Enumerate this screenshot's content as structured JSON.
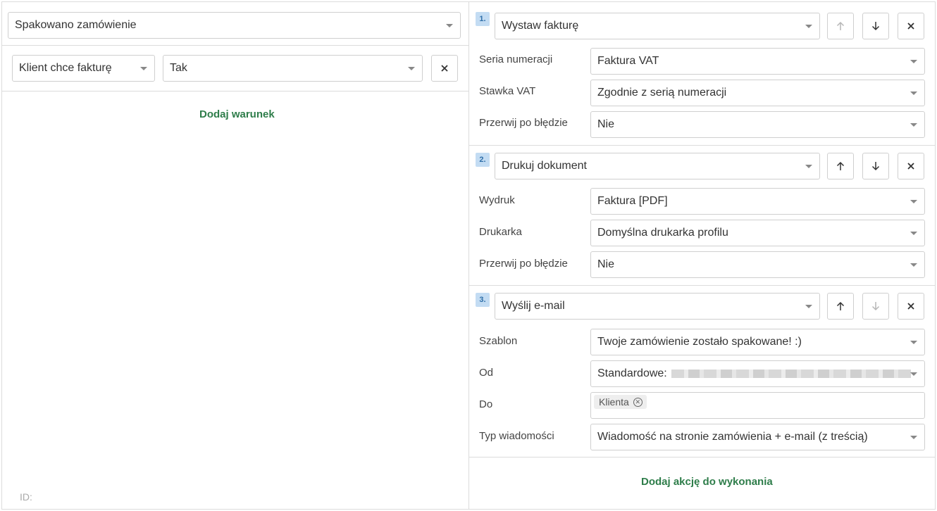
{
  "trigger": {
    "value": "Spakowano zamówienie"
  },
  "condition": {
    "field": "Klient chce fakturę",
    "value": "Tak"
  },
  "add_condition_label": "Dodaj warunek",
  "id_label": "ID:",
  "actions": [
    {
      "number": "1.",
      "type": "Wystaw fakturę",
      "params": [
        {
          "label": "Seria numeracji",
          "value": "Faktura VAT"
        },
        {
          "label": "Stawka VAT",
          "value": "Zgodnie z serią numeracji"
        },
        {
          "label": "Przerwij po błędzie",
          "value": "Nie"
        }
      ]
    },
    {
      "number": "2.",
      "type": "Drukuj dokument",
      "params": [
        {
          "label": "Wydruk",
          "value": "Faktura [PDF]"
        },
        {
          "label": "Drukarka",
          "value": "Domyślna drukarka profilu"
        },
        {
          "label": "Przerwij po błędzie",
          "value": "Nie"
        }
      ]
    },
    {
      "number": "3.",
      "type": "Wyślij e-mail",
      "params": [
        {
          "label": "Szablon",
          "value": "Twoje zamówienie zostało spakowane! :)"
        },
        {
          "label": "Od",
          "value": "Standardowe:"
        },
        {
          "label": "Do",
          "tag": "Klienta"
        },
        {
          "label": "Typ wiadomości",
          "value": "Wiadomość na stronie zamówienia + e-mail (z treścią)"
        }
      ]
    }
  ],
  "add_action_label": "Dodaj akcję do wykonania",
  "icons": {
    "move_up": "arrow-up-icon",
    "move_down": "arrow-down-icon",
    "remove": "close-icon",
    "dropdown": "caret-down-icon",
    "tag_remove": "circle-x-icon"
  },
  "colors": {
    "link_green": "#2e7d4a",
    "badge_bg": "#c3dcf3",
    "badge_text": "#2f6fa9",
    "border": "#dcdcdc"
  }
}
